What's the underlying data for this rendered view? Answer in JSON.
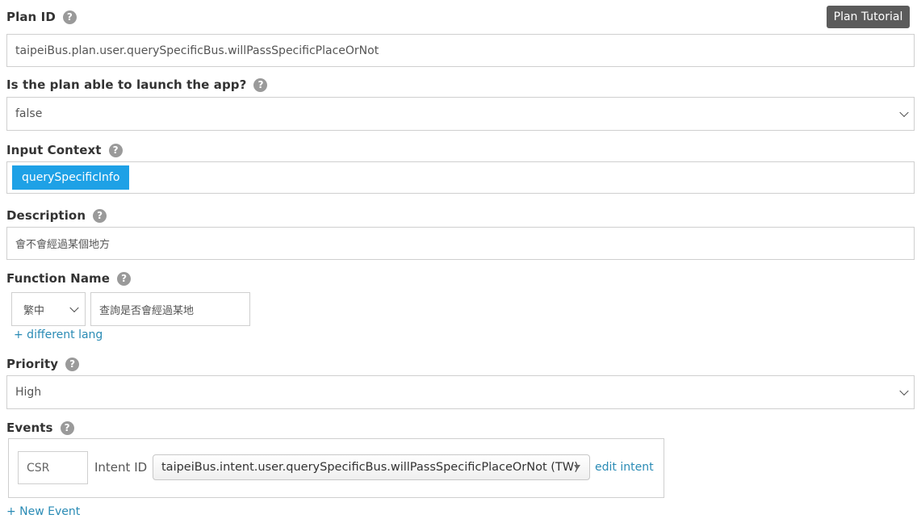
{
  "plan_id": {
    "label": "Plan ID",
    "value": "taipeiBus.plan.user.querySpecificBus.willPassSpecificPlaceOrNot"
  },
  "tutorial_button": "Plan Tutorial",
  "launch_app": {
    "label": "Is the plan able to launch the app?",
    "selected": "false"
  },
  "input_context": {
    "label": "Input Context",
    "tags": [
      "querySpecificInfo"
    ]
  },
  "description": {
    "label": "Description",
    "value": "會不會經過某個地方"
  },
  "function_name": {
    "label": "Function Name",
    "lang": "繁中",
    "value": "查詢是否會經過某地",
    "add_lang_link": "+ different lang"
  },
  "priority": {
    "label": "Priority",
    "selected": "High"
  },
  "events": {
    "label": "Events",
    "items": [
      {
        "type": "CSR",
        "intent_label": "Intent ID",
        "intent_value": "taipeiBus.intent.user.querySpecificBus.willPassSpecificPlaceOrNot (TW)",
        "edit_link": "edit intent"
      }
    ],
    "new_event_link": "+ New Event"
  },
  "help_glyph": "?",
  "icons": {
    "help": "question-circle-icon",
    "dropdown": "chevron-down-icon"
  },
  "colors": {
    "tag_bg": "#1ea1e6",
    "link": "#2a8bb5",
    "tutorial_bg": "#5b5b5b",
    "help_icon": "#9a9a9a"
  }
}
